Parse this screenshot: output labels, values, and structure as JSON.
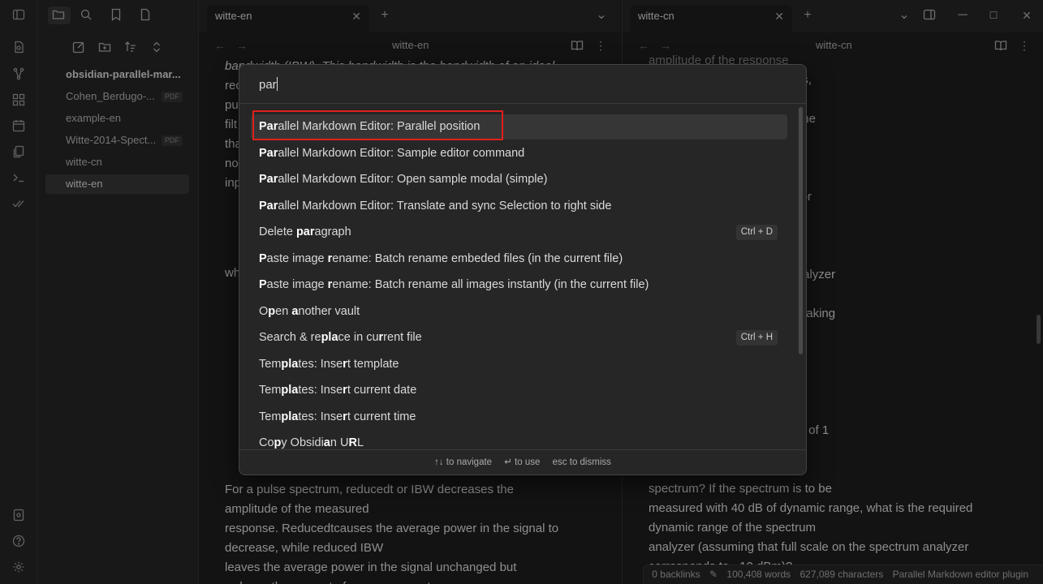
{
  "left_pane": {
    "tab_title": "witte-en",
    "nav_title": "witte-en",
    "visible_lines": [
      "bandwidth (IBW). This bandwidth is the bandwidth of an ideal",
      "rec",
      "pu",
      "filt",
      "tha",
      "no",
      "inp",
      "wh",
      "For a pulse spectrum, reducedt or IBW decreases the",
      "amplitude of the measured",
      "response. Reducedtcauses the average power in the signal to",
      "decrease, while reduced IBW",
      "leaves the average power in the signal unchanged but",
      "reduces the amount of energy present"
    ]
  },
  "right_pane": {
    "tab_title": "witte-cn",
    "nav_title": "witte-cn",
    "visible_lines": [
      "amplitude of the response",
      "er in the waveform decreases,",
      "n a",
      "ge (or attenuator setting) of the",
      "e set",
      "el of the continuous carrier.",
      "n the",
      "ut circuitry of the analyzer. For",
      "much smaller than the peak",
      "easured",
      "y lower than the full-scale analyzer",
      "to",
      "nalyzer that is available for making",
      "he",
      "ak power of −10 dBm, a PRF of 1",
      "ude of the main lobe of the",
      "spectrum? If the spectrum is to be",
      "measured with 40 dB of dynamic range, what is the required",
      "dynamic range of the spectrum",
      "analyzer (assuming that full scale on the spectrum analyzer",
      "corresponds to −10 dBm)?"
    ]
  },
  "sidebar": {
    "vault_name": "obsidian-parallel-mar...",
    "files": [
      {
        "name": "Cohen_Berdugo-...",
        "badge": "PDF"
      },
      {
        "name": "example-en",
        "badge": ""
      },
      {
        "name": "Witte-2014-Spect...",
        "badge": "PDF"
      },
      {
        "name": "witte-cn",
        "badge": ""
      },
      {
        "name": "witte-en",
        "badge": ""
      }
    ]
  },
  "palette": {
    "query": "par",
    "suggestions": [
      {
        "pre": "",
        "b1": "Par",
        "post": "allel Markdown Editor: Parallel position",
        "hotkey": ""
      },
      {
        "pre": "",
        "b1": "Par",
        "post": "allel Markdown Editor: Sample editor command",
        "hotkey": ""
      },
      {
        "pre": "",
        "b1": "Par",
        "post": "allel Markdown Editor: Open sample modal (simple)",
        "hotkey": ""
      },
      {
        "pre": "",
        "b1": "Par",
        "post": "allel Markdown Editor: Translate and sync Selection to right side",
        "hotkey": ""
      },
      {
        "pre": "Delete ",
        "b1": "par",
        "post": "agraph",
        "hotkey": "Ctrl + D"
      },
      {
        "pre": "",
        "b1": "P",
        "mid": "aste image ",
        "b2": "r",
        "post": "ename: Batch rename embeded files (in the current file)",
        "hotkey": ""
      },
      {
        "pre": "",
        "b1": "P",
        "mid": "aste image ",
        "b2": "r",
        "post": "ename: Batch rename all images instantly (in the current file)",
        "hotkey": ""
      },
      {
        "pre": "O",
        "b1": "p",
        "mid": "en ",
        "b2": "a",
        "post": "nother vault",
        "hotkey": ""
      },
      {
        "pre": "Search & re",
        "b1": "pla",
        "mid": "ce in cu",
        "b2": "r",
        "post": "rent file",
        "hotkey": "Ctrl + H"
      },
      {
        "pre": "Tem",
        "b1": "pla",
        "mid": "tes: Inse",
        "b2": "r",
        "post": "t template",
        "hotkey": ""
      },
      {
        "pre": "Tem",
        "b1": "pla",
        "mid": "tes: Inse",
        "b2": "r",
        "post": "t current date",
        "hotkey": ""
      },
      {
        "pre": "Tem",
        "b1": "pla",
        "mid": "tes: Inse",
        "b2": "r",
        "post": "t current time",
        "hotkey": ""
      },
      {
        "pre": "Co",
        "b1": "p",
        "mid": "y Obsidi",
        "b2": "a",
        "mid2": "n U",
        "b3": "R",
        "post": "L",
        "hotkey": ""
      }
    ],
    "footer": {
      "navigate": "↑↓ to navigate",
      "use": "↵ to use",
      "dismiss": "esc to dismiss"
    }
  },
  "statusbar": {
    "backlinks": "0 backlinks",
    "words": "100,408 words",
    "characters": "627,089 characters",
    "plugin": "Parallel Markdown editor plugin"
  },
  "colors": {
    "accent_highlight": "#e0201c",
    "background": "#1e1e1e",
    "sidebar_bg": "#262626"
  }
}
